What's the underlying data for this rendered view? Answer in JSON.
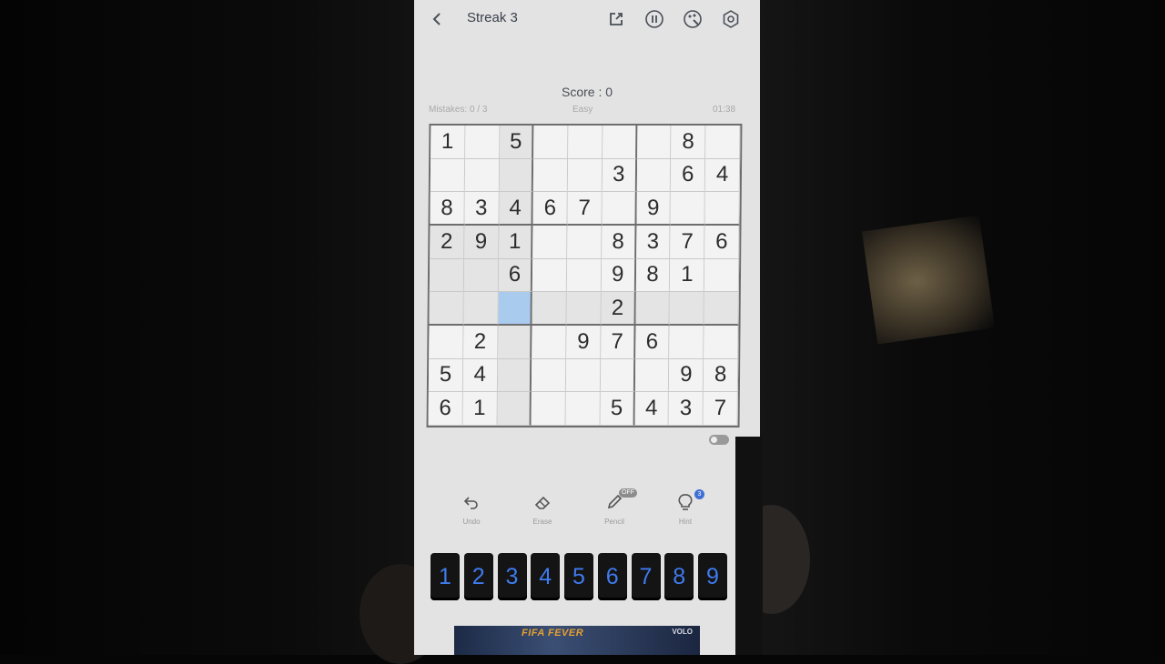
{
  "header": {
    "back_icon": "chevron-left-icon",
    "title": "Streak 3",
    "actions": [
      "share-icon",
      "pause-icon",
      "theme-palette-icon",
      "settings-gear-icon"
    ]
  },
  "score": {
    "label": "Score : 0"
  },
  "info": {
    "mistakes": "Mistakes: 0 / 3",
    "difficulty": "Easy",
    "timer": "01:38"
  },
  "board": {
    "selected": {
      "row": 5,
      "col": 2
    },
    "rows": [
      [
        "1",
        "",
        "5",
        "",
        "",
        "",
        "",
        "8",
        ""
      ],
      [
        "",
        "",
        "",
        "",
        "",
        "3",
        "",
        "6",
        "4"
      ],
      [
        "8",
        "3",
        "4",
        "6",
        "7",
        "",
        "9",
        "",
        ""
      ],
      [
        "2",
        "9",
        "1",
        "",
        "",
        "8",
        "3",
        "7",
        "6"
      ],
      [
        "",
        "",
        "6",
        "",
        "",
        "9",
        "8",
        "1",
        ""
      ],
      [
        "",
        "",
        "",
        "",
        "",
        "2",
        "",
        "",
        ""
      ],
      [
        "",
        "2",
        "",
        "",
        "9",
        "7",
        "6",
        "",
        ""
      ],
      [
        "5",
        "4",
        "",
        "",
        "",
        "",
        "",
        "9",
        "8"
      ],
      [
        "6",
        "1",
        "",
        "",
        "",
        "5",
        "4",
        "3",
        "7"
      ]
    ]
  },
  "tools": {
    "undo": "Undo",
    "erase": "Erase",
    "pencil": "Pencil",
    "pencil_badge": "OFF",
    "hint": "Hint",
    "hint_badge": "3"
  },
  "numpad": [
    "1",
    "2",
    "3",
    "4",
    "5",
    "6",
    "7",
    "8",
    "9"
  ],
  "ad": {
    "title": "FIFA FEVER",
    "brand": "VOLO"
  },
  "colors": {
    "selected_cell": "#a9cbee",
    "numpad_digit": "#3f7bef",
    "highlight_cell": "#e4e4e4"
  }
}
